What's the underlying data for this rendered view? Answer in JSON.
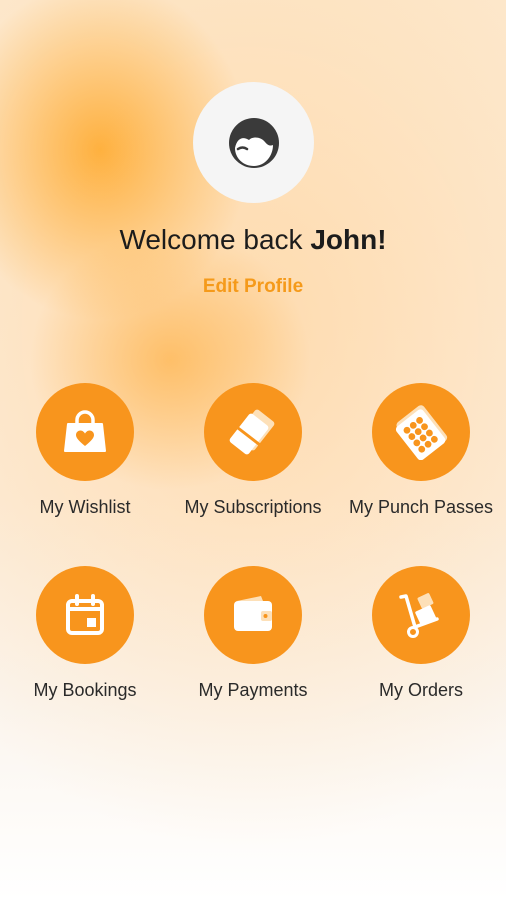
{
  "profile": {
    "avatar_icon": "user-avatar-icon",
    "welcome_prefix": "Welcome back ",
    "user_name": "John!",
    "edit_label": "Edit Profile"
  },
  "colors": {
    "accent": "#f8951d",
    "link": "#f59a1a"
  },
  "menu": [
    {
      "label": "My Wishlist",
      "icon": "shopping-bag-heart-icon"
    },
    {
      "label": "My Subscriptions",
      "icon": "cards-icon"
    },
    {
      "label": "My Punch Passes",
      "icon": "punch-pass-icon"
    },
    {
      "label": "My Bookings",
      "icon": "calendar-icon"
    },
    {
      "label": "My Payments",
      "icon": "wallet-icon"
    },
    {
      "label": "My Orders",
      "icon": "hand-truck-icon"
    }
  ]
}
